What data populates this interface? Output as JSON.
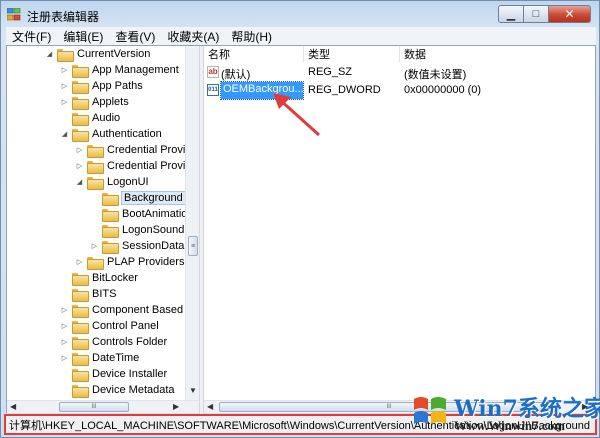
{
  "window": {
    "title": "注册表编辑器",
    "buttons": {
      "minimize": "▁",
      "maximize": "□",
      "close": "✕"
    }
  },
  "menu": [
    "文件(F)",
    "编辑(E)",
    "查看(V)",
    "收藏夹(A)",
    "帮助(H)"
  ],
  "tree": {
    "items": [
      {
        "label": "CurrentVersion",
        "expander": "◢"
      },
      {
        "label": "App Management",
        "expander": "▷"
      },
      {
        "label": "App Paths",
        "expander": "▷"
      },
      {
        "label": "Applets",
        "expander": "▷"
      },
      {
        "label": "Audio",
        "expander": ""
      },
      {
        "label": "Authentication",
        "expander": "◢"
      },
      {
        "label": "Credential Provid",
        "expander": "▷"
      },
      {
        "label": "Credential Provid",
        "expander": "▷"
      },
      {
        "label": "LogonUI",
        "expander": "◢"
      },
      {
        "label": "Background",
        "expander": ""
      },
      {
        "label": "BootAnimatio",
        "expander": ""
      },
      {
        "label": "LogonSoundP",
        "expander": ""
      },
      {
        "label": "SessionData",
        "expander": "▷"
      },
      {
        "label": "PLAP Providers",
        "expander": "▷"
      },
      {
        "label": "BitLocker",
        "expander": ""
      },
      {
        "label": "BITS",
        "expander": ""
      },
      {
        "label": "Component Based S",
        "expander": "▷"
      },
      {
        "label": "Control Panel",
        "expander": "▷"
      },
      {
        "label": "Controls Folder",
        "expander": "▷"
      },
      {
        "label": "DateTime",
        "expander": "▷"
      },
      {
        "label": "Device Installer",
        "expander": ""
      },
      {
        "label": "Device Metadata",
        "expander": ""
      }
    ],
    "selected": "Background"
  },
  "columns": {
    "name": "名称",
    "type": "类型",
    "data": "数据"
  },
  "values": [
    {
      "icon": "ab",
      "name": "(默认)",
      "type": "REG_SZ",
      "data": "(数值未设置)"
    },
    {
      "icon": "binary",
      "name": "OEMBackgrou...",
      "type": "REG_DWORD",
      "data": "0x00000000 (0)"
    }
  ],
  "scroll": {
    "thumb_glyph": "≡",
    "hthumb_glyph": "III",
    "up": "▲",
    "down": "▼",
    "left": "◀",
    "right": "▶"
  },
  "status": {
    "path": "计算机\\HKEY_LOCAL_MACHINE\\SOFTWARE\\Microsoft\\Windows\\CurrentVersion\\Authentication\\LogonUI\\Background"
  },
  "watermark": {
    "brand": "Win7系统之家",
    "url": "Www.Winwin7.com"
  },
  "colors": {
    "selection": "#3399ff",
    "annotation": "#e23b3b",
    "brand_blue": "#1c6fc4"
  }
}
